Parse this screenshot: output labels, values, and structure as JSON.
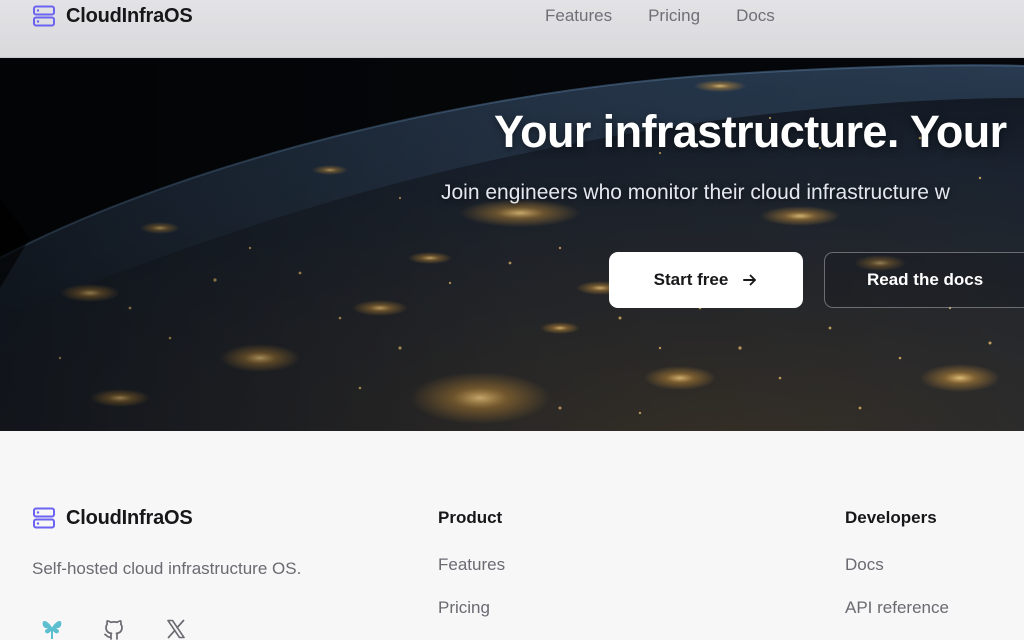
{
  "header": {
    "brand": "CloudInfraOS",
    "nav": [
      {
        "label": "Features"
      },
      {
        "label": "Pricing"
      },
      {
        "label": "Docs"
      }
    ]
  },
  "hero": {
    "title": "Your infrastructure. Your",
    "subtitle": "Join engineers who monitor their cloud infrastructure w",
    "primary_cta": "Start free",
    "secondary_cta": "Read the docs"
  },
  "footer": {
    "brand": "CloudInfraOS",
    "tagline": "Self-hosted cloud infrastructure OS.",
    "socials": [
      {
        "icon": "bluesky-icon"
      },
      {
        "icon": "github-icon"
      },
      {
        "icon": "x-icon"
      }
    ],
    "columns": [
      {
        "title": "Product",
        "links": [
          "Features",
          "Pricing"
        ]
      },
      {
        "title": "Developers",
        "links": [
          "Docs",
          "API reference"
        ]
      }
    ]
  },
  "colors": {
    "brand_icon": "#6b63f2",
    "header_bg": "#dcdce0",
    "footer_bg": "#f7f7f8",
    "text_dark": "#17171a",
    "text_muted": "#6a6a71"
  }
}
